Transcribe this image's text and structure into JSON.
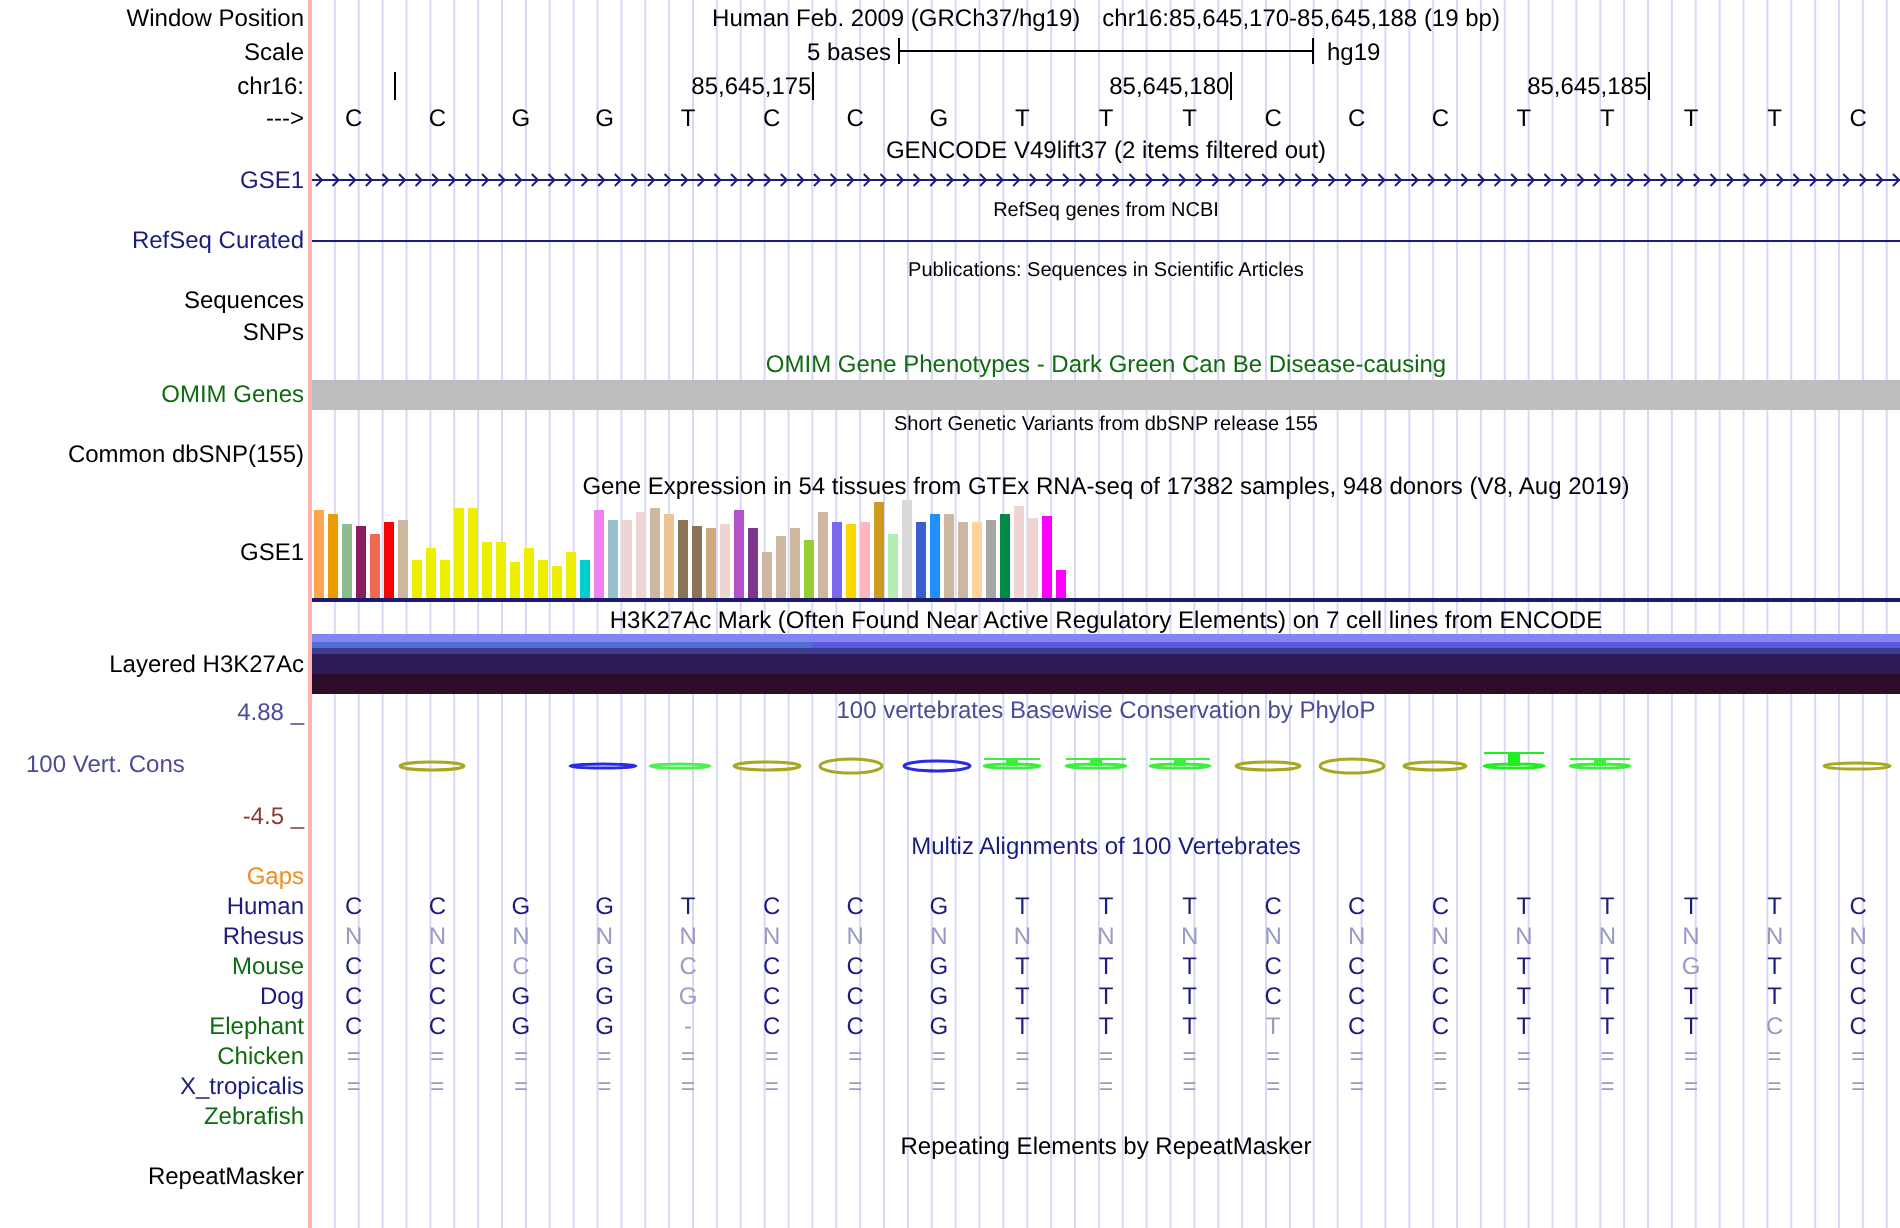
{
  "header": {
    "label": "Window Position",
    "title": "Human Feb. 2009 (GRCh37/hg19)",
    "position": "chr16:85,645,170-85,645,188 (19 bp)"
  },
  "scale": {
    "label": "Scale",
    "length": "5 bases",
    "assembly": "hg19"
  },
  "ruler": {
    "label": "chr16:",
    "ticks": [
      {
        "kind": "minor"
      },
      {
        "kind": "major",
        "label": "85,645,175"
      },
      {
        "kind": "major",
        "label": "85,645,180"
      },
      {
        "kind": "major",
        "label": "85,645,185"
      }
    ]
  },
  "sequence": {
    "label": "--->",
    "bases": [
      "C",
      "C",
      "G",
      "G",
      "T",
      "C",
      "C",
      "G",
      "T",
      "T",
      "T",
      "C",
      "C",
      "C",
      "T",
      "T",
      "T",
      "T",
      "C"
    ]
  },
  "tracks": [
    {
      "kind": "rows",
      "compact": false,
      "title": "GENCODE V49lift37 (2 items filtered out)",
      "rows": [
        {
          "label": "GSE1",
          "color": "#1c1c80",
          "kind": "arrows"
        }
      ]
    },
    {
      "kind": "rows",
      "compact": true,
      "title": "RefSeq genes from NCBI",
      "rows": [
        {
          "label": "RefSeq Curated",
          "color": "#1c1c80",
          "kind": "line"
        }
      ]
    },
    {
      "kind": "rows",
      "compact": true,
      "title": "Publications: Sequences in Scientific Articles",
      "rows": [
        {
          "label": "Sequences",
          "kind": "empty"
        },
        {
          "label": "SNPs",
          "kind": "empty"
        }
      ]
    },
    {
      "kind": "rows",
      "compact": false,
      "title": "OMIM Gene Phenotypes - Dark Green Can Be Disease-causing",
      "color": "#106a10",
      "rows": [
        {
          "label": "OMIM Genes",
          "color": "#106a10",
          "kind": "bar"
        }
      ]
    },
    {
      "kind": "rows",
      "compact": true,
      "title": "Short Genetic Variants from dbSNP release 155",
      "rows": [
        {
          "label": "Common dbSNP(155)",
          "kind": "empty"
        }
      ]
    },
    {
      "kind": "rows",
      "compact": false,
      "title": "Gene Expression in 54 tissues from GTEx RNA-seq of 17382 samples, 948 donors (V8, Aug 2019)",
      "rows": [
        {
          "label": "GSE1",
          "kind": "expression"
        }
      ]
    },
    {
      "kind": "rows",
      "compact": false,
      "title": "H3K27Ac Mark (Often Found Near Active Regulatory Elements) on 7 cell lines from ENCODE",
      "rows": [
        {
          "label": "Layered H3K27Ac",
          "kind": "histone"
        }
      ]
    },
    {
      "kind": "conservation",
      "compact": false,
      "title": "100 vertebrates Basewise Conservation by PhyloP",
      "color": "#4b4b96",
      "label": "100 Vert. Cons",
      "max": "4.88 _",
      "min": "-4.5 _"
    },
    {
      "kind": "alignment",
      "compact": false,
      "title": "Multiz Alignments of 100 Vertebrates",
      "color": "#1c1c80",
      "gaps": {
        "label": "Gaps",
        "color": "#f08c1a"
      },
      "species": [
        {
          "name": "Human",
          "color": "#1c1c80",
          "bases": [
            "C",
            "C",
            "G",
            "G",
            "T",
            "C",
            "C",
            "G",
            "T",
            "T",
            "T",
            "C",
            "C",
            "C",
            "T",
            "T",
            "T",
            "T",
            "C"
          ],
          "differs": [
            false,
            false,
            false,
            false,
            false,
            false,
            false,
            false,
            false,
            false,
            false,
            false,
            false,
            false,
            false,
            false,
            false,
            false,
            false
          ]
        },
        {
          "name": "Rhesus",
          "color": "#1c1c80",
          "bases": [
            "N",
            "N",
            "N",
            "N",
            "N",
            "N",
            "N",
            "N",
            "N",
            "N",
            "N",
            "N",
            "N",
            "N",
            "N",
            "N",
            "N",
            "N",
            "N"
          ],
          "differs": [
            true,
            true,
            true,
            true,
            true,
            true,
            true,
            true,
            true,
            true,
            true,
            true,
            true,
            true,
            true,
            true,
            true,
            true,
            true
          ]
        },
        {
          "name": "Mouse",
          "color": "#106a10",
          "bases": [
            "C",
            "C",
            "C",
            "G",
            "C",
            "C",
            "C",
            "G",
            "T",
            "T",
            "T",
            "C",
            "C",
            "C",
            "T",
            "T",
            "G",
            "T",
            "C"
          ],
          "differs": [
            false,
            false,
            true,
            false,
            true,
            false,
            false,
            false,
            false,
            false,
            false,
            false,
            false,
            false,
            false,
            false,
            true,
            false,
            false
          ]
        },
        {
          "name": "Dog",
          "color": "#1c1c80",
          "bases": [
            "C",
            "C",
            "G",
            "G",
            "G",
            "C",
            "C",
            "G",
            "T",
            "T",
            "T",
            "C",
            "C",
            "C",
            "T",
            "T",
            "T",
            "T",
            "C"
          ],
          "differs": [
            false,
            false,
            false,
            false,
            true,
            false,
            false,
            false,
            false,
            false,
            false,
            false,
            false,
            false,
            false,
            false,
            false,
            false,
            false
          ]
        },
        {
          "name": "Elephant",
          "color": "#106a10",
          "bases": [
            "C",
            "C",
            "G",
            "G",
            "-",
            "C",
            "C",
            "G",
            "T",
            "T",
            "T",
            "T",
            "C",
            "C",
            "T",
            "T",
            "T",
            "C",
            "C"
          ],
          "differs": [
            false,
            false,
            false,
            false,
            true,
            false,
            false,
            false,
            false,
            false,
            false,
            true,
            false,
            false,
            false,
            false,
            false,
            true,
            false
          ]
        },
        {
          "name": "Chicken",
          "color": "#106a10",
          "bases": [
            "=",
            "=",
            "=",
            "=",
            "=",
            "=",
            "=",
            "=",
            "=",
            "=",
            "=",
            "=",
            "=",
            "=",
            "=",
            "=",
            "=",
            "=",
            "="
          ],
          "differs": [
            true,
            true,
            true,
            true,
            true,
            true,
            true,
            true,
            true,
            true,
            true,
            true,
            true,
            true,
            true,
            true,
            true,
            true,
            true
          ]
        },
        {
          "name": "X_tropicalis",
          "color": "#1c1c80",
          "bases": [
            "=",
            "=",
            "=",
            "=",
            "=",
            "=",
            "=",
            "=",
            "=",
            "=",
            "=",
            "=",
            "=",
            "=",
            "=",
            "=",
            "=",
            "=",
            "="
          ],
          "differs": [
            true,
            true,
            true,
            true,
            true,
            true,
            true,
            true,
            true,
            true,
            true,
            true,
            true,
            true,
            true,
            true,
            true,
            true,
            true
          ]
        },
        {
          "name": "Zebrafish",
          "color": "#106a10"
        }
      ]
    },
    {
      "kind": "rows",
      "compact": false,
      "title": "Repeating Elements by RepeatMasker",
      "rows": [
        {
          "label": "RepeatMasker",
          "kind": "empty"
        }
      ]
    }
  ]
}
